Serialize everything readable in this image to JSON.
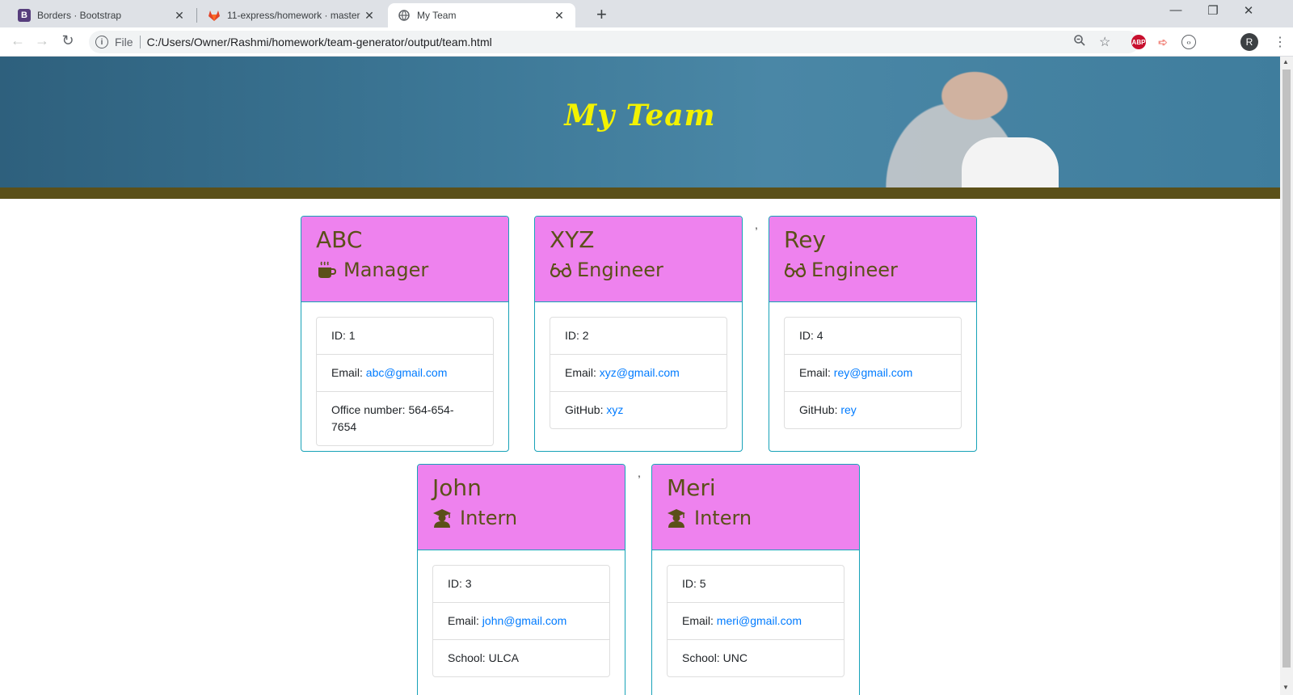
{
  "browser": {
    "tabs": [
      {
        "title": "Borders · Bootstrap",
        "favicon": "B"
      },
      {
        "title": "11-express/homework · master ·",
        "favicon": "gitlab-icon"
      },
      {
        "title": "My Team",
        "favicon": "globe-icon"
      }
    ],
    "address": {
      "scheme_label": "File",
      "url": "C:/Users/Owner/Rashmi/homework/team-generator/output/team.html"
    },
    "profile_initial": "R",
    "extensions": [
      "ABP"
    ]
  },
  "page": {
    "title": "My Team",
    "separator": ",",
    "colors": {
      "header_bg": "#ee82ee",
      "header_text": "#5b5019",
      "card_border": "#17a2b8",
      "title_color": "#f2f201",
      "band_color": "#5b5019",
      "link": "#007bff"
    },
    "members": [
      {
        "name": "ABC",
        "role": "Manager",
        "icon": "coffee-icon",
        "id_label": "ID: 1",
        "email_label": "Email: ",
        "email": "abc@gmail.com",
        "extra_label": "Office number: ",
        "extra_value": "564-654-7654",
        "extra_is_link": false
      },
      {
        "name": "XYZ",
        "role": "Engineer",
        "icon": "glasses-icon",
        "id_label": "ID: 2",
        "email_label": "Email: ",
        "email": "xyz@gmail.com",
        "extra_label": "GitHub: ",
        "extra_value": "xyz",
        "extra_is_link": true
      },
      {
        "name": "Rey",
        "role": "Engineer",
        "icon": "glasses-icon",
        "id_label": "ID: 4",
        "email_label": "Email: ",
        "email": "rey@gmail.com",
        "extra_label": "GitHub: ",
        "extra_value": "rey",
        "extra_is_link": true
      },
      {
        "name": "John",
        "role": "Intern",
        "icon": "graduate-icon",
        "id_label": "ID: 3",
        "email_label": "Email: ",
        "email": "john@gmail.com",
        "extra_label": "School: ",
        "extra_value": "ULCA",
        "extra_is_link": false
      },
      {
        "name": "Meri",
        "role": "Intern",
        "icon": "graduate-icon",
        "id_label": "ID: 5",
        "email_label": "Email: ",
        "email": "meri@gmail.com",
        "extra_label": "School: ",
        "extra_value": "UNC",
        "extra_is_link": false
      }
    ]
  }
}
